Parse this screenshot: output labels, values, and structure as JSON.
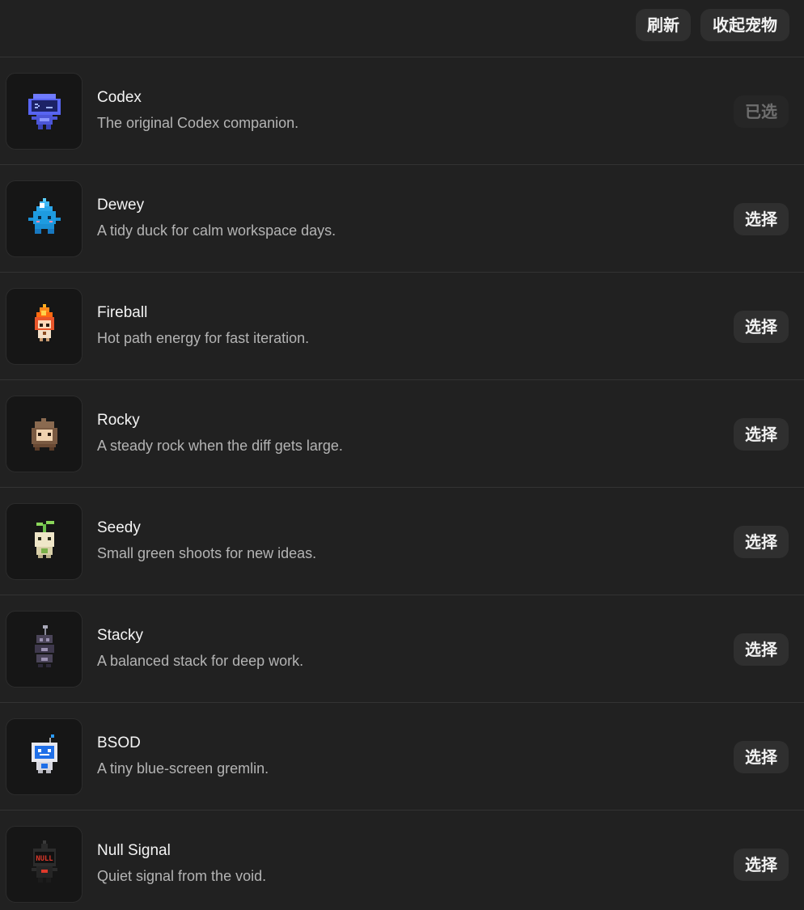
{
  "toolbar": {
    "refresh_label": "刷新",
    "collapse_label": "收起宠物"
  },
  "pets": [
    {
      "name": "Codex",
      "description": "The original Codex companion.",
      "button": "已选",
      "selected": true,
      "icon": "codex-cloud-icon"
    },
    {
      "name": "Dewey",
      "description": "A tidy duck for calm workspace days.",
      "button": "选择",
      "selected": false,
      "icon": "dewey-droplet-icon"
    },
    {
      "name": "Fireball",
      "description": "Hot path energy for fast iteration.",
      "button": "选择",
      "selected": false,
      "icon": "fireball-flame-icon"
    },
    {
      "name": "Rocky",
      "description": "A steady rock when the diff gets large.",
      "button": "选择",
      "selected": false,
      "icon": "rocky-rock-icon"
    },
    {
      "name": "Seedy",
      "description": "Small green shoots for new ideas.",
      "button": "选择",
      "selected": false,
      "icon": "seedy-sprout-icon"
    },
    {
      "name": "Stacky",
      "description": "A balanced stack for deep work.",
      "button": "选择",
      "selected": false,
      "icon": "stacky-stack-icon"
    },
    {
      "name": "BSOD",
      "description": "A tiny blue-screen gremlin.",
      "button": "选择",
      "selected": false,
      "icon": "bsod-monitor-icon"
    },
    {
      "name": "Null Signal",
      "description": "Quiet signal from the void.",
      "button": "选择",
      "selected": false,
      "icon": "null-signal-robot-icon",
      "icon_text": "NULL"
    }
  ]
}
